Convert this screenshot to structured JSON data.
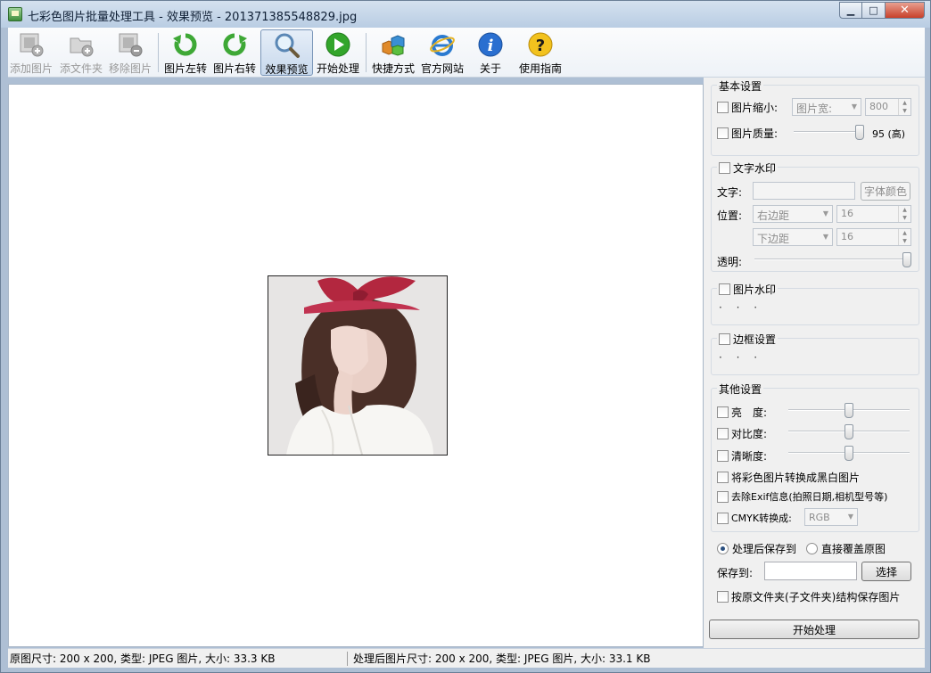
{
  "window": {
    "title": "七彩色图片批量处理工具 - 效果预览 - 201371385548829.jpg"
  },
  "toolbar": {
    "items": [
      {
        "label": "添加图片",
        "icon": "add-image-icon",
        "disabled": true
      },
      {
        "label": "添文件夹",
        "icon": "add-folder-icon",
        "disabled": true
      },
      {
        "label": "移除图片",
        "icon": "remove-image-icon",
        "disabled": true
      },
      {
        "label": "图片左转",
        "icon": "rotate-left-icon",
        "disabled": false
      },
      {
        "label": "图片右转",
        "icon": "rotate-right-icon",
        "disabled": false
      },
      {
        "label": "效果预览",
        "icon": "preview-magnifier-icon",
        "disabled": false,
        "active": true
      },
      {
        "label": "开始处理",
        "icon": "play-icon",
        "disabled": false
      },
      {
        "label": "快捷方式",
        "icon": "shortcut-blocks-icon",
        "disabled": false
      },
      {
        "label": "官方网站",
        "icon": "ie-browser-icon",
        "disabled": false
      },
      {
        "label": "关于",
        "icon": "info-icon",
        "disabled": false
      },
      {
        "label": "使用指南",
        "icon": "help-icon",
        "disabled": false
      }
    ]
  },
  "panel": {
    "basic": {
      "title": "基本设置",
      "resize_label": "图片缩小:",
      "resize_mode": "图片宽:",
      "resize_value": "800",
      "quality_label": "图片质量:",
      "quality_value": 95,
      "quality_text": "95 (高)"
    },
    "text_watermark": {
      "title": "文字水印",
      "text_label": "文字:",
      "text_value": "",
      "font_color_button": "字体颜色",
      "position_label": "位置:",
      "h_align": "右边距",
      "h_margin": "16",
      "v_align": "下边距",
      "v_margin": "16",
      "opacity_label": "透明:",
      "opacity_fraction": 0.98
    },
    "image_watermark": {
      "title": "图片水印",
      "placeholder": "· · ·"
    },
    "border": {
      "title": "边框设置",
      "placeholder": "· · ·"
    },
    "other": {
      "title": "其他设置",
      "brightness_label": "亮　度:",
      "brightness_fraction": 0.5,
      "contrast_label": "对比度:",
      "contrast_fraction": 0.5,
      "sharpness_label": "清晰度:",
      "sharpness_fraction": 0.5,
      "grayscale_label": "将彩色图片转换成黑白图片",
      "exif_label": "去除Exif信息(拍照日期,相机型号等)",
      "cmyk_label": "CMYK转换成:",
      "cmyk_value": "RGB"
    },
    "save": {
      "radio_save_to": "处理后保存到",
      "radio_overwrite": "直接覆盖原图",
      "selected": "save_to",
      "save_path_label": "保存到:",
      "save_path_value": "",
      "choose_button": "选择",
      "keep_structure_label": "按原文件夹(子文件夹)结构保存图片"
    },
    "start_button": "开始处理"
  },
  "status": {
    "original": "原图尺寸: 200 x 200, 类型: JPEG 图片, 大小: 33.3 KB",
    "processed": "处理后图片尺寸: 200 x 200, 类型: JPEG 图片, 大小: 33.1 KB"
  },
  "colors": {
    "title_bar": "#c4d5e8",
    "close_button": "#c8402a",
    "ribbon_red": "#b3273f"
  }
}
